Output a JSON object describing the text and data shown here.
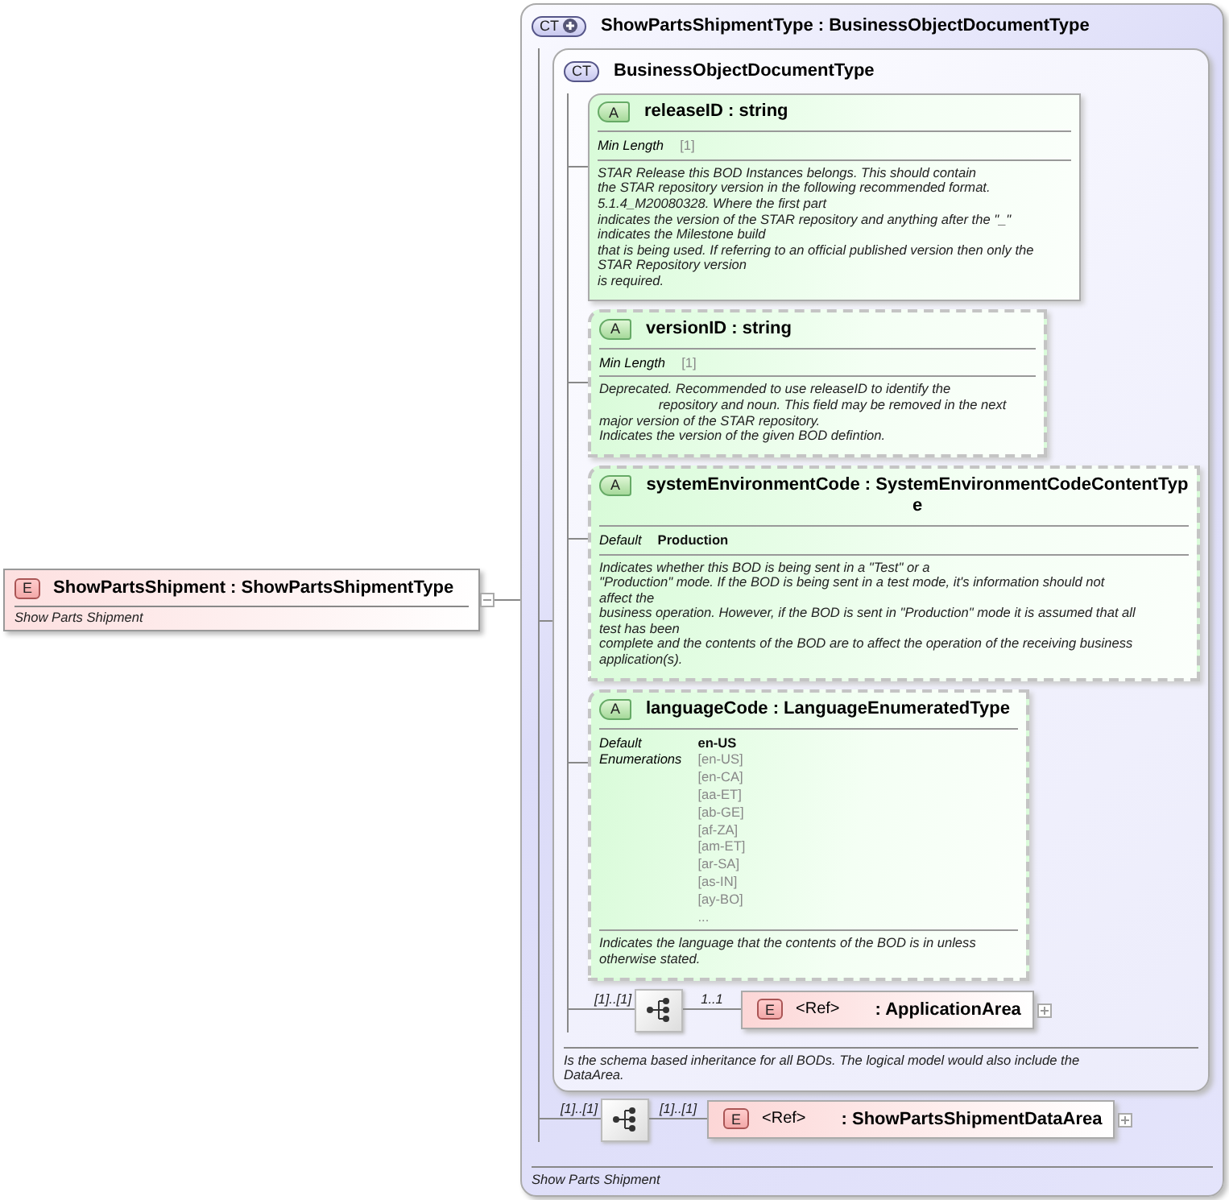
{
  "root_element": {
    "badge": "E",
    "title": "ShowPartsShipment : ShowPartsShipmentType",
    "doc": "Show Parts Shipment",
    "expanded": true
  },
  "complex_type": {
    "badge": "CT",
    "extension": true,
    "title": "ShowPartsShipmentType : BusinessObjectDocumentType",
    "base_type": {
      "badge": "CT",
      "extension": false,
      "title": "BusinessObjectDocumentType",
      "attributes": [
        {
          "badge": "A",
          "title": "releaseID : string",
          "optional": false,
          "facets": [
            {
              "kind": "length",
              "label": "Min Length",
              "values": [
                "[1]"
              ]
            }
          ],
          "doc": "STAR Release this BOD Instances belongs. This should contain\nthe STAR repository version in the following recommended format.\n5.1.4_M20080328. Where the first part\nindicates the version of the STAR repository and anything after the \"_\"\nindicates the Milestone build\nthat is being used. If referring to an official published version then only the\nSTAR Repository version\nis required."
        },
        {
          "badge": "A",
          "title": "versionID : string",
          "optional": true,
          "facets": [
            {
              "kind": "length",
              "label": "Min Length",
              "values": [
                "[1]"
              ]
            }
          ],
          "doc": "Deprecated. Recommended to use releaseID to identify the\n                repository and noun. This field may be removed in the next\nmajor version of the STAR repository.\nIndicates the version of the given BOD defintion."
        },
        {
          "badge": "A",
          "title": "systemEnvironmentCode : SystemEnvironmentCodeContentType",
          "optional": true,
          "facets": [
            {
              "kind": "default",
              "label": "Default",
              "values": [
                "Production"
              ]
            }
          ],
          "doc": "Indicates whether this BOD is being sent in a \"Test\" or a\n\"Production\" mode. If the BOD is being sent in a test mode, it's information should not\naffect the\nbusiness operation. However, if the BOD is sent in \"Production\" mode it is assumed that all\ntest has been\ncomplete and the contents of the BOD are to affect the operation of the receiving business\napplication(s)."
        },
        {
          "badge": "A",
          "title": "languageCode : LanguageEnumeratedType",
          "optional": true,
          "facets": [
            {
              "kind": "default",
              "label": "Default",
              "values": [
                "en-US"
              ]
            },
            {
              "kind": "enumeration",
              "label": "Enumerations",
              "values": [
                "[en-US]",
                "[en-CA]",
                "[aa-ET]",
                "[ab-GE]",
                "[af-ZA]",
                "[am-ET]",
                "[ar-SA]",
                "[as-IN]",
                "[ay-BO]",
                "..."
              ]
            }
          ],
          "doc": "Indicates the language that the contents of the BOD is in unless\notherwise stated."
        }
      ],
      "sequence": {
        "occurs": "[1]..[1]",
        "ref_occurs": "1..1",
        "ref": {
          "badge": "E",
          "name": "<Ref>",
          "type": ": ApplicationArea",
          "expanded": false
        }
      },
      "doc": "Is the schema based inheritance for all BODs. The logical model would also include the\nDataArea."
    },
    "sequence": {
      "occurs": "[1]..[1]",
      "ref_occurs": "[1]..[1]",
      "ref": {
        "badge": "E",
        "name": "<Ref>",
        "type": ": ShowPartsShipmentDataArea",
        "expanded": false
      }
    },
    "doc": "Show Parts Shipment"
  }
}
